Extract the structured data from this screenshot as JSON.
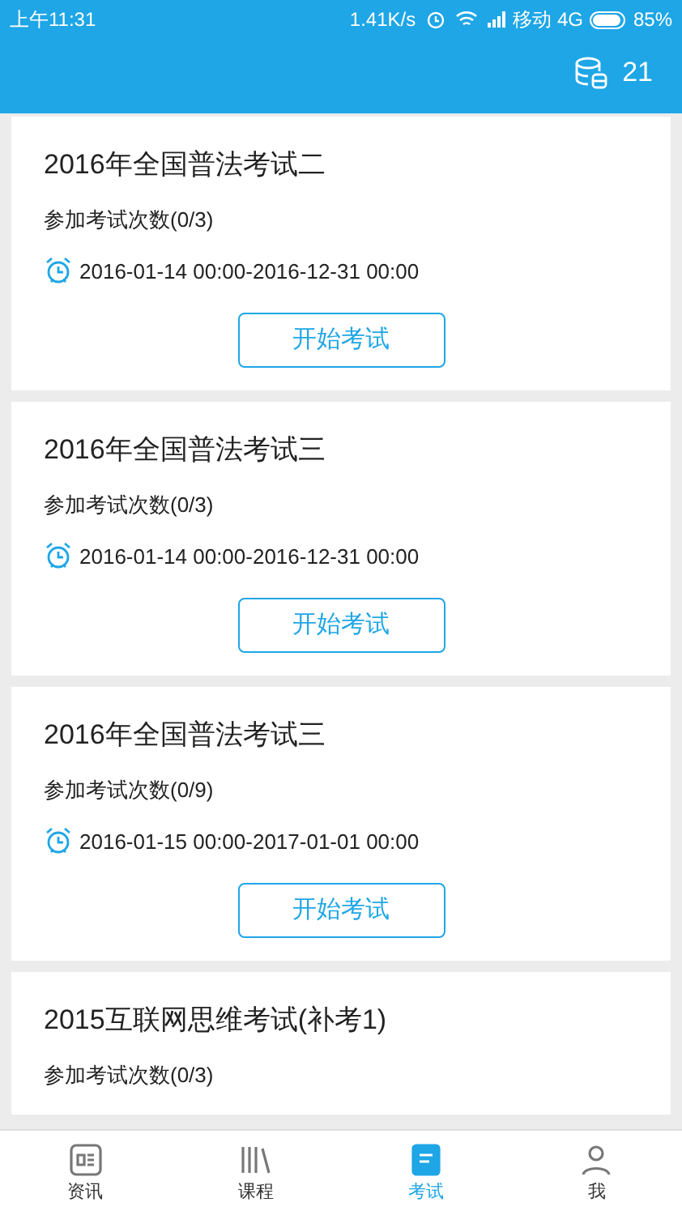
{
  "status_bar": {
    "time": "上午11:31",
    "speed": "1.41K/s",
    "carrier": "移动 4G",
    "battery": "85%"
  },
  "header": {
    "coins": "21"
  },
  "exams": [
    {
      "title": "2016年全国普法考试二",
      "attempts": "参加考试次数(0/3)",
      "period": "2016-01-14 00:00-2016-12-31 00:00",
      "button": "开始考试"
    },
    {
      "title": "2016年全国普法考试三",
      "attempts": "参加考试次数(0/3)",
      "period": "2016-01-14 00:00-2016-12-31 00:00",
      "button": "开始考试"
    },
    {
      "title": "2016年全国普法考试三",
      "attempts": "参加考试次数(0/9)",
      "period": "2016-01-15 00:00-2017-01-01 00:00",
      "button": "开始考试"
    },
    {
      "title": "2015互联网思维考试(补考1)",
      "attempts": "参加考试次数(0/3)"
    }
  ],
  "tab_bar": [
    {
      "kind": "news",
      "label": "资讯",
      "selected": false
    },
    {
      "kind": "courses",
      "label": "课程",
      "selected": false
    },
    {
      "kind": "exam",
      "label": "考试",
      "selected": true
    },
    {
      "kind": "me",
      "label": "我",
      "selected": false
    }
  ]
}
